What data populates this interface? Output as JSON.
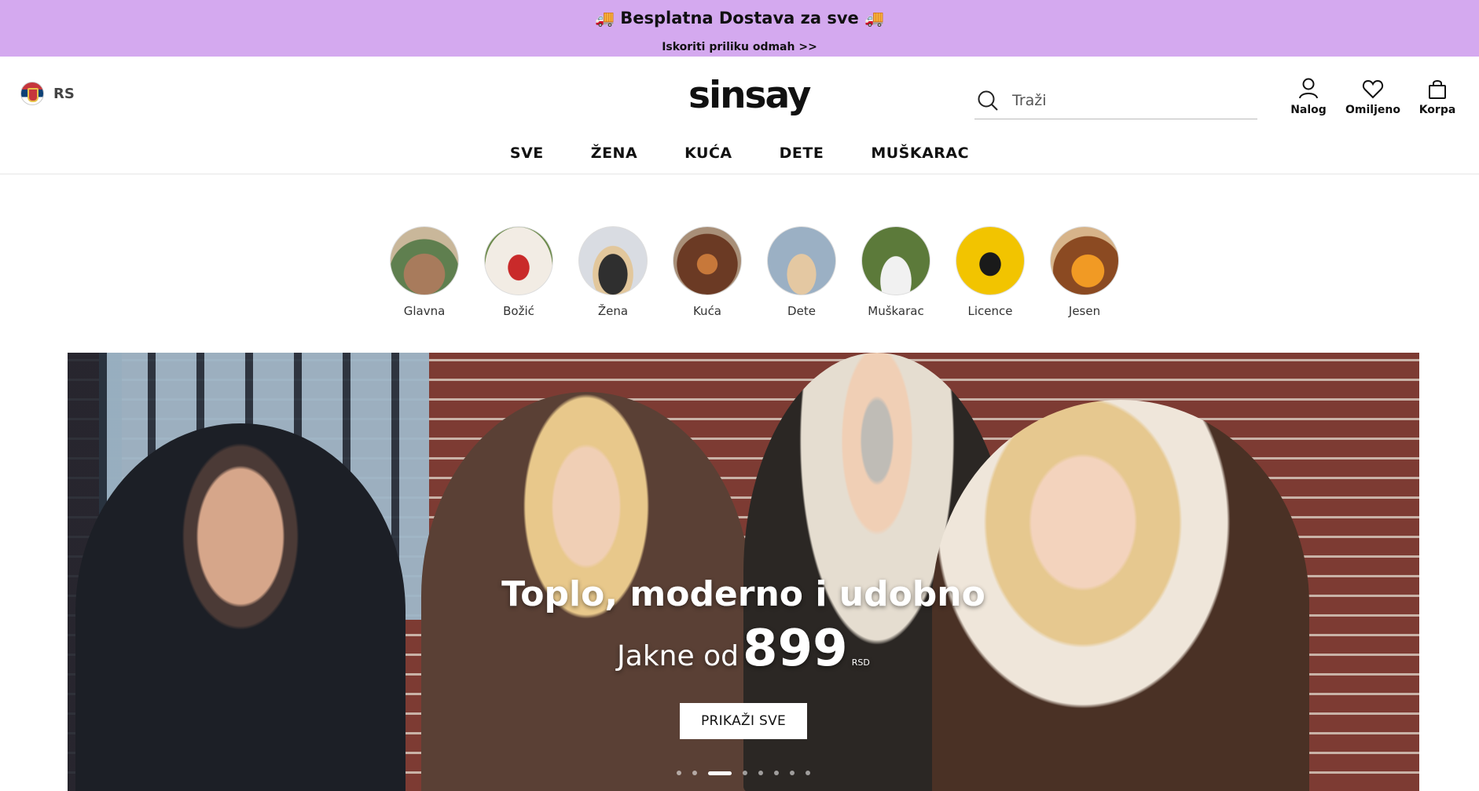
{
  "promo": {
    "title": "Besplatna Dostava za sve",
    "subtitle": "Iskoriti priliku odmah >>"
  },
  "header": {
    "country_code": "RS",
    "logo": "sinsay",
    "search_placeholder": "Traži",
    "actions": [
      {
        "label": "Nalog",
        "icon": "user-icon"
      },
      {
        "label": "Omiljeno",
        "icon": "heart-icon"
      },
      {
        "label": "Korpa",
        "icon": "bag-icon"
      }
    ]
  },
  "nav": [
    "SVE",
    "ŽENA",
    "KUĆA",
    "DETE",
    "MUŠKARAC"
  ],
  "stories": [
    {
      "label": "Glavna",
      "color": "#8a6a52"
    },
    {
      "label": "Božić",
      "color": "#c92a2a"
    },
    {
      "label": "Žena",
      "color": "#3d3d3d"
    },
    {
      "label": "Kuća",
      "color": "#7b4a2c"
    },
    {
      "label": "Dete",
      "color": "#9bb0c4"
    },
    {
      "label": "Muškarac",
      "color": "#5c7a3a"
    },
    {
      "label": "Licence",
      "color": "#f2c400"
    },
    {
      "label": "Jesen",
      "color": "#e38a1e"
    }
  ],
  "hero": {
    "title": "Toplo, moderno i udobno",
    "price_prefix": "Jakne od",
    "price_value": "899",
    "price_currency": "RSD",
    "button_label": "PRIKAŽI SVE",
    "slide_count": 8,
    "active_slide": 2
  }
}
